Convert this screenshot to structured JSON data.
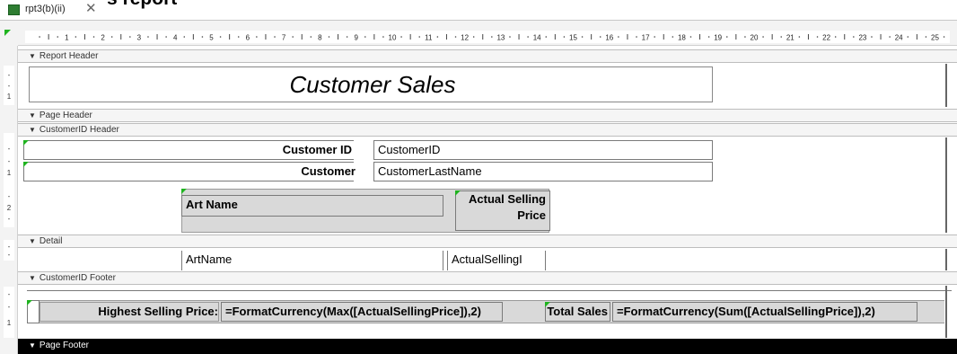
{
  "document": {
    "heading": "stomer Sales report"
  },
  "tab": {
    "label": "rpt3(b)(ii)",
    "close": "✕"
  },
  "ruler": {
    "marks": [
      "1",
      "2",
      "3",
      "4",
      "5",
      "6",
      "7",
      "8",
      "9",
      "10",
      "11",
      "12",
      "13",
      "14",
      "15",
      "16",
      "17",
      "18",
      "19",
      "20",
      "21",
      "22",
      "23",
      "24",
      "25"
    ]
  },
  "sections": {
    "report_header": {
      "label": "Report Header"
    },
    "page_header": {
      "label": "Page Header"
    },
    "customer_header": {
      "label": "CustomerID Header"
    },
    "detail": {
      "label": "Detail"
    },
    "customer_footer": {
      "label": "CustomerID Footer"
    },
    "page_footer": {
      "label": "Page Footer"
    }
  },
  "report_title": "Customer Sales",
  "customer_header": {
    "customer_id_label": "Customer ID",
    "customer_id_field": "CustomerID",
    "customer_label": "Customer",
    "customer_field": "CustomerLastName",
    "art_name_heading": "Art Name",
    "actual_selling_heading_1": "Actual Selling",
    "actual_selling_heading_2": "Price"
  },
  "detail": {
    "art_name_field": "ArtName",
    "actual_selling_field": "ActualSellingI"
  },
  "customer_footer": {
    "highest_label": "Highest Selling Price:",
    "highest_expr": "=FormatCurrency(Max([ActualSellingPrice]),2)",
    "total_label": "Total Sales",
    "total_expr": "=FormatCurrency(Sum([ActualSellingPrice]),2)"
  },
  "vruler_marks": {
    "report_header": [
      "-",
      "-",
      "1"
    ],
    "customer_header": [
      "-",
      "-",
      "1",
      "-",
      "2",
      "-"
    ],
    "detail": [
      "-",
      "-"
    ],
    "customer_footer": [
      "-",
      "-",
      "1"
    ]
  }
}
